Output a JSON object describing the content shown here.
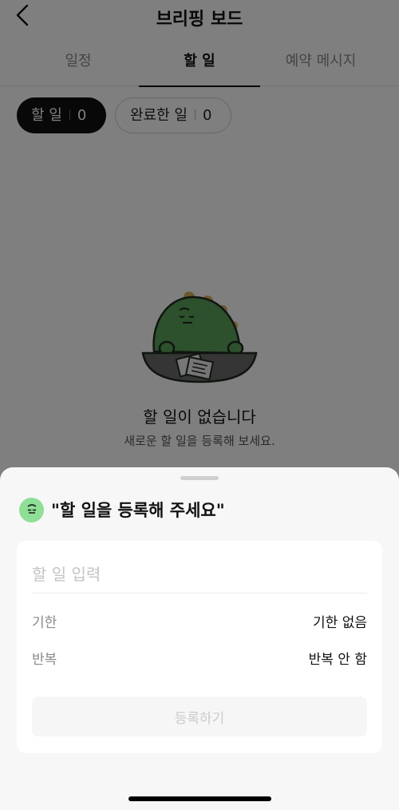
{
  "header": {
    "title": "브리핑 보드",
    "back_icon": "chevron-left-icon"
  },
  "tabs": [
    {
      "label": "일정",
      "selected": false
    },
    {
      "label": "할 일",
      "selected": true
    },
    {
      "label": "예약 메시지",
      "selected": false
    }
  ],
  "filters": [
    {
      "label": "할 일",
      "count": "0",
      "selected": true
    },
    {
      "label": "완료한 일",
      "count": "0",
      "selected": false
    }
  ],
  "empty_state": {
    "illustration": "dinosaur-illustration",
    "title": "할 일이 없습니다",
    "subtitle": "새로운 할 일을 등록해 보세요."
  },
  "sheet": {
    "title": "\"할 일을 등록해 주세요\"",
    "avatar_icon": "dino-face-icon",
    "input": {
      "placeholder": "할 일 입력",
      "value": ""
    },
    "rows": [
      {
        "label": "기한",
        "value": "기한 없음"
      },
      {
        "label": "반복",
        "value": "반복 안 함"
      }
    ],
    "submit_label": "등록하기"
  },
  "colors": {
    "accent_dark": "#111111",
    "avatar_green": "#8fdf96",
    "dino_green": "#5aa05a",
    "dim_overlay": "rgba(0,0,0,0.5)",
    "sheet_bg": "#f7f7f7"
  }
}
